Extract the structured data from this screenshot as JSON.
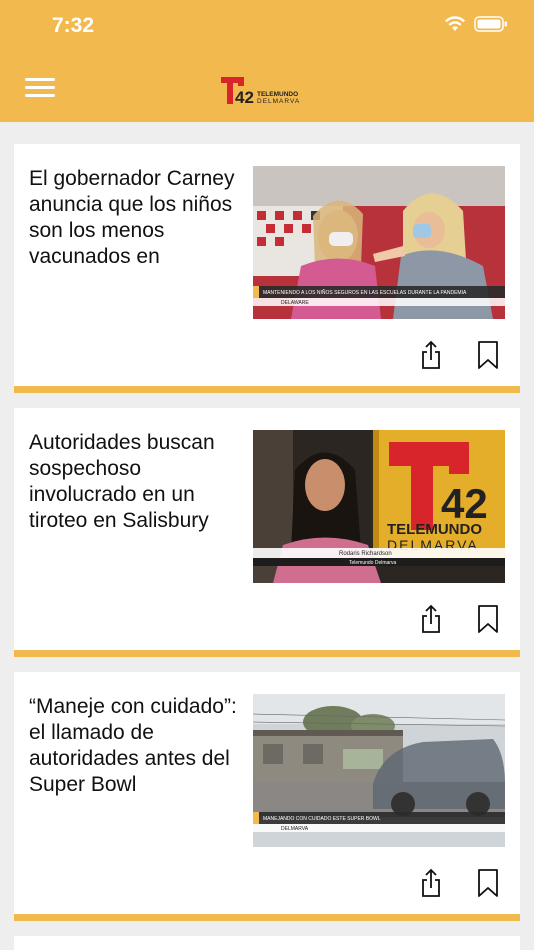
{
  "status_bar": {
    "time": "7:32"
  },
  "header": {
    "logo_number": "42",
    "logo_line1": "TELEMUNDO",
    "logo_line2": "DELMARVA"
  },
  "articles": [
    {
      "title": "El gobernador Carney anuncia que los niños son los menos vacunados en",
      "thumb_caption": "MANTENIENDO A LOS NIÑOS SEGUROS EN LAS ESCUELAS DURANTE LA PANDEMIA",
      "thumb_location": "DELAWARE"
    },
    {
      "title": "Autoridades buscan sospechoso involucrado en un tiroteo en Salisbury",
      "thumb_name": "Rodaris Richardson",
      "thumb_org": "Telemundo Delmarva",
      "thumb_logo_number": "42",
      "thumb_logo_line1": "TELEMUNDO",
      "thumb_logo_line2": "DELMARVA"
    },
    {
      "title": "“Maneje con cuidado”: el llamado de autoridades antes del Super Bowl",
      "thumb_caption": "MANEJANDO CON CUIDADO ESTE SUPER BOWL",
      "thumb_location": "DELMARVA"
    }
  ],
  "colors": {
    "accent": "#f2b94f",
    "brand_red": "#d8252c"
  },
  "icons": {
    "share": "share-icon",
    "bookmark": "bookmark-icon",
    "menu": "hamburger-menu-icon"
  }
}
